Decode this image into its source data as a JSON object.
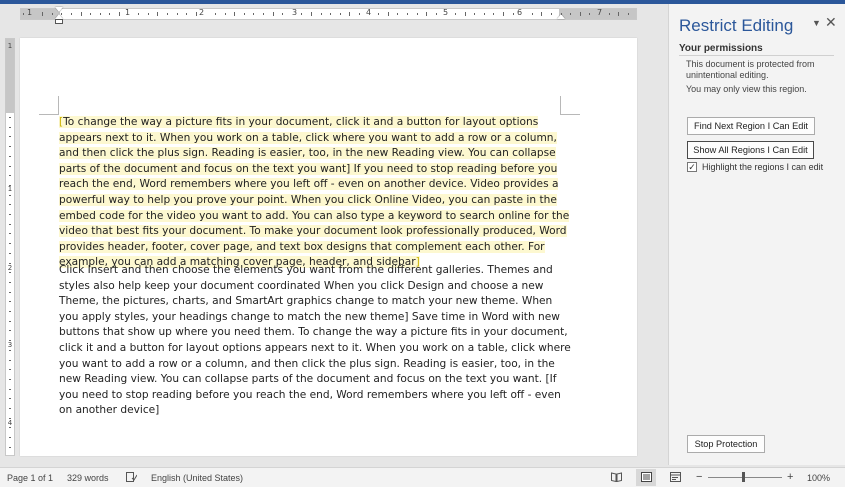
{
  "ruler": {
    "h_numbers": [
      "1",
      "1",
      "2",
      "3",
      "4",
      "5",
      "6",
      "7"
    ],
    "v_numbers": [
      "1",
      "1",
      "2",
      "3",
      "4"
    ]
  },
  "document": {
    "paragraph1": "To change the way a picture fits in your document, click it and a button for layout options appears next to it. When you work on a table, click where you want to add a row or a column, and then click the plus sign. Reading is easier, too, in the new Reading view. You can collapse parts of the document and focus on the text you want] If you need to stop reading before you reach the end, Word remembers where you left off - even on another device. Video provides a powerful way to help you prove your point. When you click Online Video, you can paste in the embed code for the video you want to add. You can also type a keyword to search online for the video that best fits your document. To make your document look professionally produced, Word provides header, footer, cover page, and text box designs that complement each other. For example, you can add a matching cover page, header, and sidebar",
    "paragraph2": "Click Insert and then choose the elements you want from the different galleries. Themes and styles also help keep your document coordinated When you click Design and choose a new Theme, the pictures, charts, and SmartArt graphics change to match your new theme. When you apply styles, your headings change to match the new theme] Save time in Word with new buttons that show up where you need them. To change the way a picture fits in your document, click it and a button for layout options appears next to it. When you work on a table, click where you want to add a row or a column, and then click the plus sign. Reading is easier, too, in the new Reading view. You can collapse parts of the document and focus on the text you want. [If you need to stop reading before you reach the end, Word remembers where you left off - even on another device]",
    "region_open": "[",
    "region_close": "]"
  },
  "pane": {
    "title": "Restrict Editing",
    "dropdown_icon": "▼",
    "close_icon": "✕",
    "permissions_heading": "Your permissions",
    "protected_text": "This document is protected from unintentional editing.",
    "view_text": "You may only view this region.",
    "find_next_label": "Find Next Region I Can Edit",
    "show_all_label": "Show All Regions I Can Edit",
    "highlight_checked": true,
    "highlight_mark": "✓",
    "highlight_label": "Highlight the regions I can edit",
    "stop_label": "Stop Protection"
  },
  "status": {
    "page": "Page 1 of 1",
    "words": "329 words",
    "language": "English (United States)",
    "zoom_minus": "−",
    "zoom_plus": "+",
    "zoom": "100%"
  },
  "colors": {
    "accent": "#2b579a",
    "highlight": "#fdf8d0",
    "bracket": "#c9b200"
  }
}
